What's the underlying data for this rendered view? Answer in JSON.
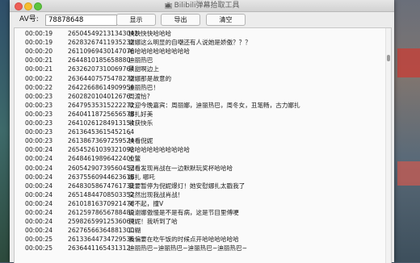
{
  "window": {
    "title": "Bilibili弹幕拾取工具",
    "title_icon": "bilibili-tv-icon"
  },
  "toolbar": {
    "av_label": "AV号:",
    "av_value": "78878648",
    "show_label": "显示",
    "export_label": "导出",
    "clear_label": "清空"
  },
  "danmaku": [
    {
      "time": "00:00:19",
      "uid": "2650454921313430​42",
      "text": "快快快快哈哈哈"
    },
    {
      "time": "00:00:19",
      "uid": "2628326741193523​2",
      "text": "谢娜这么明显的自嘲还有人说她是娇傲？？？"
    },
    {
      "time": "00:00:20",
      "uid": "2611096943014707​6",
      "text": "哈哈哈哈哈哈哈哈哈哈"
    },
    {
      "time": "00:00:21",
      "uid": "2644810185658880",
      "text": "迪丽热巴"
    },
    {
      "time": "00:00:21",
      "uid": "2632620731006976​4",
      "text": "景甜啊边上"
    },
    {
      "time": "00:00:22",
      "uid": "2636440757547827​2",
      "text": "谢娜那是故意的"
    },
    {
      "time": "00:00:22",
      "uid": "2642266861490995​6",
      "text": "迪丽热巴！"
    },
    {
      "time": "00:00:23",
      "uid": "2602820104012676",
      "text": "周渡恰?"
    },
    {
      "time": "00:00:23",
      "uid": "2647953531522227​2",
      "text": "欢迎今晚嘉宾：周丽娜，迪丽热巴，周冬女，丑笔畅，古力娜扎"
    },
    {
      "time": "00:00:23",
      "uid": "2640411872565657​8",
      "text": "娜扎好美"
    },
    {
      "time": "00:00:23",
      "uid": "2641026128491315​4",
      "text": "收获快乐"
    },
    {
      "time": "00:00:23",
      "uid": "2613645361545216​4",
      "text": "。"
    },
    {
      "time": "00:00:23",
      "uid": "2613867369725952​4",
      "text": "快看倪妮"
    },
    {
      "time": "00:00:24",
      "uid": "2654526103932109​2",
      "text": "哈哈哈哈哈哈哈哈哈哈"
    },
    {
      "time": "00:00:24",
      "uid": "2648461989642240​0",
      "text": "土鳖"
    },
    {
      "time": "00:00:24",
      "uid": "2605429073956045​2",
      "text": "回看发现肖战在一边默默玩奖杯哈哈哈"
    },
    {
      "time": "00:00:24",
      "uid": "2637556094462361​6",
      "text": "娜扎 哪吒"
    },
    {
      "time": "00:00:24",
      "uid": "2648305867476173​2",
      "text": "我要暂停为倪妮爆灯！她安慰娜扎太戳我了"
    },
    {
      "time": "00:00:24",
      "uid": "2651484470850335​2",
      "text": "突然出现我战肖战！"
    },
    {
      "time": "00:00:24",
      "uid": "2610181637092147​6",
      "text": "对不起，撞V"
    },
    {
      "time": "00:00:24",
      "uid": "2612597865678848​0",
      "text": "说谢娜傲慢是不是有病，这是节目里傅哽"
    },
    {
      "time": "00:00:24",
      "uid": "2598265991253606​4",
      "text": "倪妮！我听到了哈"
    },
    {
      "time": "00:00:24",
      "uid": "2627656636488130​0",
      "text": "口糊"
    },
    {
      "time": "00:00:25",
      "uid": "2613364473472953​6",
      "text": "我偏要在吃午饭的时候点开哈哈哈哈哈哈"
    },
    {
      "time": "00:00:25",
      "uid": "2636441165431312",
      "text": "迪丽热巴~迪丽热巴~迪丽热巴~迪丽热巴~"
    }
  ]
}
